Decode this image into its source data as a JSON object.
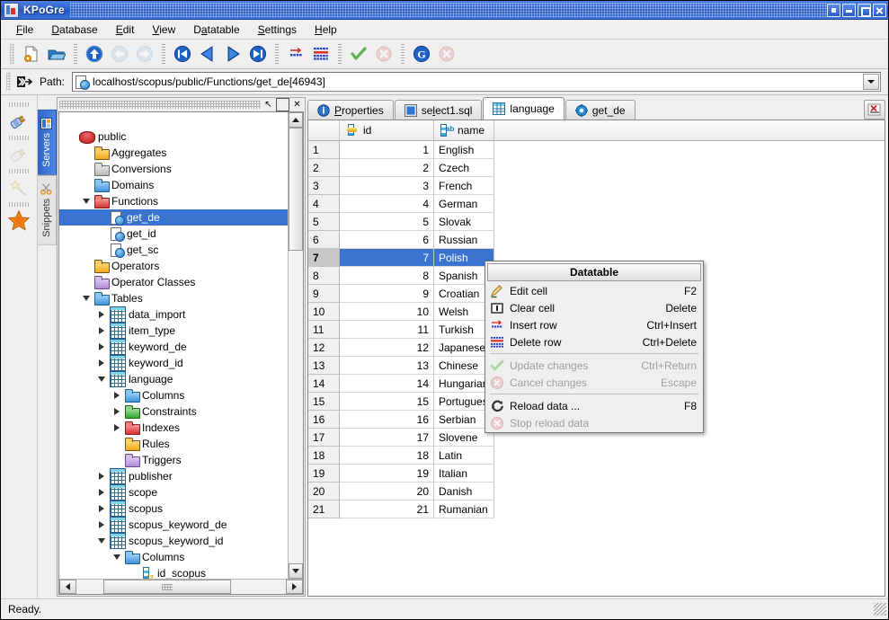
{
  "window": {
    "title": "KPoGre",
    "icon": "database-window-icon",
    "buttons": [
      {
        "name": "shade-button",
        "label": "Shade"
      },
      {
        "name": "minimize-button",
        "label": "Minimize"
      },
      {
        "name": "maximize-button",
        "label": "Maximize"
      },
      {
        "name": "close-button",
        "label": "Close"
      }
    ]
  },
  "menubar": {
    "items": [
      {
        "label": "File",
        "accel": "F"
      },
      {
        "label": "Database",
        "accel": "D"
      },
      {
        "label": "Edit",
        "accel": "E"
      },
      {
        "label": "View",
        "accel": "V"
      },
      {
        "label": "Datatable",
        "accel": "a"
      },
      {
        "label": "Settings",
        "accel": "S"
      },
      {
        "label": "Help",
        "accel": "H"
      }
    ]
  },
  "toolbar": {
    "buttons": [
      {
        "name": "new-document-button",
        "icon": "new-document-icon",
        "enabled": true
      },
      {
        "name": "open-folder-button",
        "icon": "open-folder-icon",
        "enabled": true
      },
      {
        "name": "go-up-button",
        "icon": "arrow-up-circle-icon",
        "enabled": true
      },
      {
        "name": "go-back-button",
        "icon": "arrow-left-circle-icon",
        "enabled": false
      },
      {
        "name": "go-forward-button",
        "icon": "arrow-right-circle-icon",
        "enabled": false
      },
      {
        "name": "first-record-button",
        "icon": "skip-first-icon",
        "enabled": true
      },
      {
        "name": "previous-record-button",
        "icon": "previous-triangle-icon",
        "enabled": true
      },
      {
        "name": "next-record-button",
        "icon": "next-triangle-icon",
        "enabled": true
      },
      {
        "name": "last-record-button",
        "icon": "skip-last-icon",
        "enabled": true
      },
      {
        "name": "insert-row-button",
        "icon": "insert-row-icon",
        "enabled": true
      },
      {
        "name": "delete-row-button",
        "icon": "delete-row-icon",
        "enabled": true
      },
      {
        "name": "update-changes-button",
        "icon": "green-check-icon",
        "enabled": true
      },
      {
        "name": "cancel-changes-button",
        "icon": "red-cancel-icon",
        "enabled": false
      },
      {
        "name": "reload-data-button",
        "icon": "reload-circle-icon",
        "enabled": true
      },
      {
        "name": "stop-reload-button",
        "icon": "red-cancel-icon",
        "enabled": false
      }
    ]
  },
  "pathbar": {
    "icon": "path-arrow-icon",
    "label": "Path:",
    "value": "localhost/scopus/public/Functions/get_de[46943]",
    "value_icon": "function-icon",
    "dropdown_icon": "chevron-down-icon"
  },
  "rail": {
    "icons": [
      {
        "name": "connect-plug-icon",
        "enabled": true
      },
      {
        "name": "disconnect-plug-icon",
        "enabled": false
      },
      {
        "name": "magic-wand-icon",
        "enabled": false
      },
      {
        "name": "favorites-star-icon",
        "enabled": true
      }
    ]
  },
  "vtabs": [
    {
      "label": "Servers",
      "icon": "servers-icon",
      "active": true
    },
    {
      "label": "Snippets",
      "icon": "scissors-icon",
      "active": false
    }
  ],
  "dock": {
    "buttons": [
      {
        "name": "float-panel-button",
        "glyph": "↖"
      },
      {
        "name": "maximize-panel-button",
        "glyph": "□"
      },
      {
        "name": "close-panel-button",
        "glyph": "✕"
      }
    ]
  },
  "tree": {
    "nodes": [
      {
        "label": "public",
        "indent": 0,
        "icon": "database-icon",
        "twisty": "none",
        "selected": false
      },
      {
        "label": "Aggregates",
        "indent": 1,
        "icon": "folder-yellow-icon",
        "twisty": "none",
        "selected": false
      },
      {
        "label": "Conversions",
        "indent": 1,
        "icon": "folder-gray-icon",
        "twisty": "none",
        "selected": false
      },
      {
        "label": "Domains",
        "indent": 1,
        "icon": "folder-blue-icon",
        "twisty": "none",
        "selected": false
      },
      {
        "label": "Functions",
        "indent": 1,
        "icon": "folder-red-icon",
        "twisty": "down",
        "selected": false
      },
      {
        "label": "get_de",
        "indent": 2,
        "icon": "function-icon",
        "twisty": "none",
        "selected": true
      },
      {
        "label": "get_id",
        "indent": 2,
        "icon": "function-icon",
        "twisty": "none",
        "selected": false
      },
      {
        "label": "get_sc",
        "indent": 2,
        "icon": "function-icon",
        "twisty": "none",
        "selected": false
      },
      {
        "label": "Operators",
        "indent": 1,
        "icon": "folder-yellow-icon",
        "twisty": "none",
        "selected": false
      },
      {
        "label": "Operator Classes",
        "indent": 1,
        "icon": "folder-violet-icon",
        "twisty": "none",
        "selected": false
      },
      {
        "label": "Tables",
        "indent": 1,
        "icon": "folder-blue-icon",
        "twisty": "down",
        "selected": false
      },
      {
        "label": "data_import",
        "indent": 2,
        "icon": "table-icon",
        "twisty": "right",
        "selected": false
      },
      {
        "label": "item_type",
        "indent": 2,
        "icon": "table-icon",
        "twisty": "right",
        "selected": false
      },
      {
        "label": "keyword_de",
        "indent": 2,
        "icon": "table-icon",
        "twisty": "right",
        "selected": false
      },
      {
        "label": "keyword_id",
        "indent": 2,
        "icon": "table-icon",
        "twisty": "right",
        "selected": false
      },
      {
        "label": "language",
        "indent": 2,
        "icon": "table-icon",
        "twisty": "down",
        "selected": false
      },
      {
        "label": "Columns",
        "indent": 3,
        "icon": "folder-blue-icon",
        "twisty": "right",
        "selected": false
      },
      {
        "label": "Constraints",
        "indent": 3,
        "icon": "folder-green-icon",
        "twisty": "right",
        "selected": false
      },
      {
        "label": "Indexes",
        "indent": 3,
        "icon": "folder-red-icon",
        "twisty": "right",
        "selected": false
      },
      {
        "label": "Rules",
        "indent": 3,
        "icon": "folder-yellow-icon",
        "twisty": "none",
        "selected": false
      },
      {
        "label": "Triggers",
        "indent": 3,
        "icon": "folder-violet-icon",
        "twisty": "none",
        "selected": false
      },
      {
        "label": "publisher",
        "indent": 2,
        "icon": "table-icon",
        "twisty": "right",
        "selected": false
      },
      {
        "label": "scope",
        "indent": 2,
        "icon": "table-icon",
        "twisty": "right",
        "selected": false
      },
      {
        "label": "scopus",
        "indent": 2,
        "icon": "table-icon",
        "twisty": "right",
        "selected": false
      },
      {
        "label": "scopus_keyword_de",
        "indent": 2,
        "icon": "table-icon",
        "twisty": "right",
        "selected": false
      },
      {
        "label": "scopus_keyword_id",
        "indent": 2,
        "icon": "table-icon",
        "twisty": "down",
        "selected": false
      },
      {
        "label": "Columns",
        "indent": 3,
        "icon": "folder-blue-icon",
        "twisty": "down",
        "selected": false
      },
      {
        "label": "id_scopus",
        "indent": 4,
        "icon": "column-int-icon",
        "twisty": "none",
        "selected": false
      }
    ]
  },
  "tabs": [
    {
      "label": "Properties",
      "accel": "P",
      "icon": "info-icon",
      "active": false
    },
    {
      "label": "select1.sql",
      "accel": "l",
      "icon": "sql-icon",
      "active": false
    },
    {
      "label": "language",
      "accel": "g",
      "icon": "table-icon",
      "active": true
    },
    {
      "label": "get_de",
      "accel": "g",
      "icon": "function-gear-icon",
      "active": false
    }
  ],
  "tab_close_button": {
    "name": "close-tab-button",
    "icon": "close-tab-icon"
  },
  "grid": {
    "columns": [
      {
        "key": "rowno",
        "label": "",
        "icon": ""
      },
      {
        "key": "id",
        "label": "id",
        "icon": "column-int-key-icon"
      },
      {
        "key": "name",
        "label": "name",
        "icon": "column-text-icon"
      }
    ],
    "rows": [
      {
        "no": "1",
        "id": "1",
        "name": "English",
        "selected": false
      },
      {
        "no": "2",
        "id": "2",
        "name": "Czech",
        "selected": false
      },
      {
        "no": "3",
        "id": "3",
        "name": "French",
        "selected": false
      },
      {
        "no": "4",
        "id": "4",
        "name": "German",
        "selected": false
      },
      {
        "no": "5",
        "id": "5",
        "name": "Slovak",
        "selected": false
      },
      {
        "no": "6",
        "id": "6",
        "name": "Russian",
        "selected": false
      },
      {
        "no": "7",
        "id": "7",
        "name": "Polish",
        "selected": true
      },
      {
        "no": "8",
        "id": "8",
        "name": "Spanish",
        "selected": false
      },
      {
        "no": "9",
        "id": "9",
        "name": "Croatian",
        "selected": false
      },
      {
        "no": "10",
        "id": "10",
        "name": "Welsh",
        "selected": false
      },
      {
        "no": "11",
        "id": "11",
        "name": "Turkish",
        "selected": false
      },
      {
        "no": "12",
        "id": "12",
        "name": "Japanese",
        "selected": false
      },
      {
        "no": "13",
        "id": "13",
        "name": "Chinese",
        "selected": false
      },
      {
        "no": "14",
        "id": "14",
        "name": "Hungarian",
        "selected": false
      },
      {
        "no": "15",
        "id": "15",
        "name": "Portuguese",
        "selected": false
      },
      {
        "no": "16",
        "id": "16",
        "name": "Serbian",
        "selected": false
      },
      {
        "no": "17",
        "id": "17",
        "name": "Slovene",
        "selected": false
      },
      {
        "no": "18",
        "id": "18",
        "name": "Latin",
        "selected": false
      },
      {
        "no": "19",
        "id": "19",
        "name": "Italian",
        "selected": false
      },
      {
        "no": "20",
        "id": "20",
        "name": "Danish",
        "selected": false
      },
      {
        "no": "21",
        "id": "21",
        "name": "Rumanian",
        "selected": false
      }
    ]
  },
  "context_menu": {
    "title": "Datatable",
    "items": [
      {
        "label": "Edit cell",
        "accel": "F2",
        "icon": "edit-cell-icon",
        "enabled": true,
        "sep_after": false
      },
      {
        "label": "Clear cell",
        "accel": "Delete",
        "icon": "clear-cell-icon",
        "enabled": true,
        "sep_after": false
      },
      {
        "label": "Insert row",
        "accel": "Ctrl+Insert",
        "icon": "insert-row-icon",
        "enabled": true,
        "sep_after": false
      },
      {
        "label": "Delete row",
        "accel": "Ctrl+Delete",
        "icon": "delete-row-icon",
        "enabled": true,
        "sep_after": true
      },
      {
        "label": "Update changes",
        "accel": "Ctrl+Return",
        "icon": "green-check-icon",
        "enabled": false,
        "sep_after": false
      },
      {
        "label": "Cancel changes",
        "accel": "Escape",
        "icon": "red-cancel-icon",
        "enabled": false,
        "sep_after": true
      },
      {
        "label": "Reload data ...",
        "accel": "F8",
        "icon": "reload-icon",
        "enabled": true,
        "sep_after": false
      },
      {
        "label": "Stop reload data",
        "accel": "",
        "icon": "red-cancel-icon",
        "enabled": false,
        "sep_after": false
      }
    ]
  },
  "statusbar": {
    "text": "Ready."
  },
  "colors": {
    "titlebar": "#2e63cf",
    "selection": "#3a74d0",
    "window_bg": "#efefef",
    "grid_bg": "#ffffff"
  }
}
